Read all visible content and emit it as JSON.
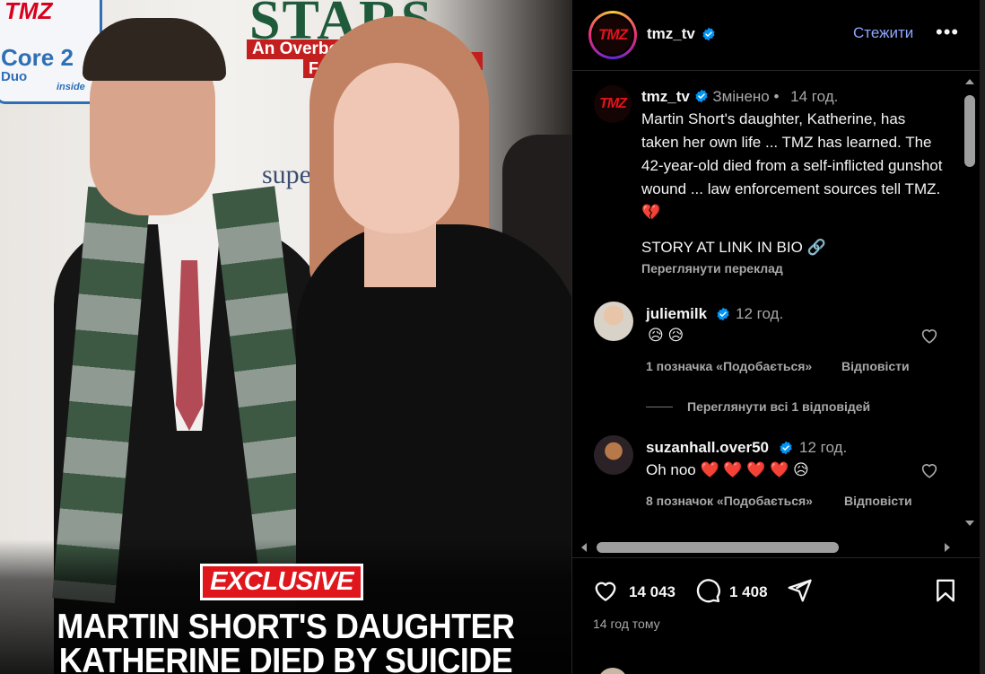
{
  "media": {
    "backdrop": {
      "tmz_text": "TMZ",
      "intel_core": "Core 2",
      "intel_duo": "Duo",
      "intel_inside": "inside",
      "stars": "STARS",
      "overbo": "An Overbo",
      "fo": "Fo",
      "super": "supe"
    },
    "badge": "EXCLUSIVE",
    "headline_line1": "MARTIN SHORT'S DAUGHTER",
    "headline_line2": "KATHERINE DIED BY SUICIDE"
  },
  "header": {
    "avatar_text": "TMZ",
    "username": "tmz_tv",
    "follow_label": "Стежити",
    "more_label": "•••"
  },
  "post": {
    "avatar_text": "TMZ",
    "username": "tmz_tv",
    "edited": "Змінено",
    "separator": "•",
    "time": "14 год.",
    "caption": "Martin Short's daughter, Katherine, has taken her own life ... TMZ has learned. The 42-year-old died from a self-inflicted gunshot wound ... law enforcement sources tell TMZ. 💔",
    "story_link": "STORY AT LINK IN BIO 🔗",
    "translate": "Переглянути переклад"
  },
  "comments": [
    {
      "username": "juliemilk",
      "time": "12 год.",
      "text": "😥 😥",
      "likes": "1 позначка «Подобається»",
      "reply": "Відповісти"
    },
    {
      "username": "suzanhall.over50",
      "time": "12 год.",
      "text": "Oh noo ❤️ ❤️ ❤️ ❤️ 😥",
      "likes": "8 позначок «Подобається»",
      "reply": "Відповісти"
    }
  ],
  "view_replies": "Переглянути всі 1 відповідей",
  "actions": {
    "likes_count": "14 043",
    "comments_count": "1 408",
    "time_ago": "14 год тому"
  },
  "colors": {
    "accent_blue": "#8ea7ff",
    "verified_blue": "#0095f6",
    "tmz_red": "#e4131b",
    "text_grey": "#a8a8a8"
  },
  "icons": [
    "verified-badge-icon",
    "heart-icon",
    "comment-icon",
    "share-icon",
    "bookmark-icon",
    "link-icon",
    "more-icon"
  ]
}
